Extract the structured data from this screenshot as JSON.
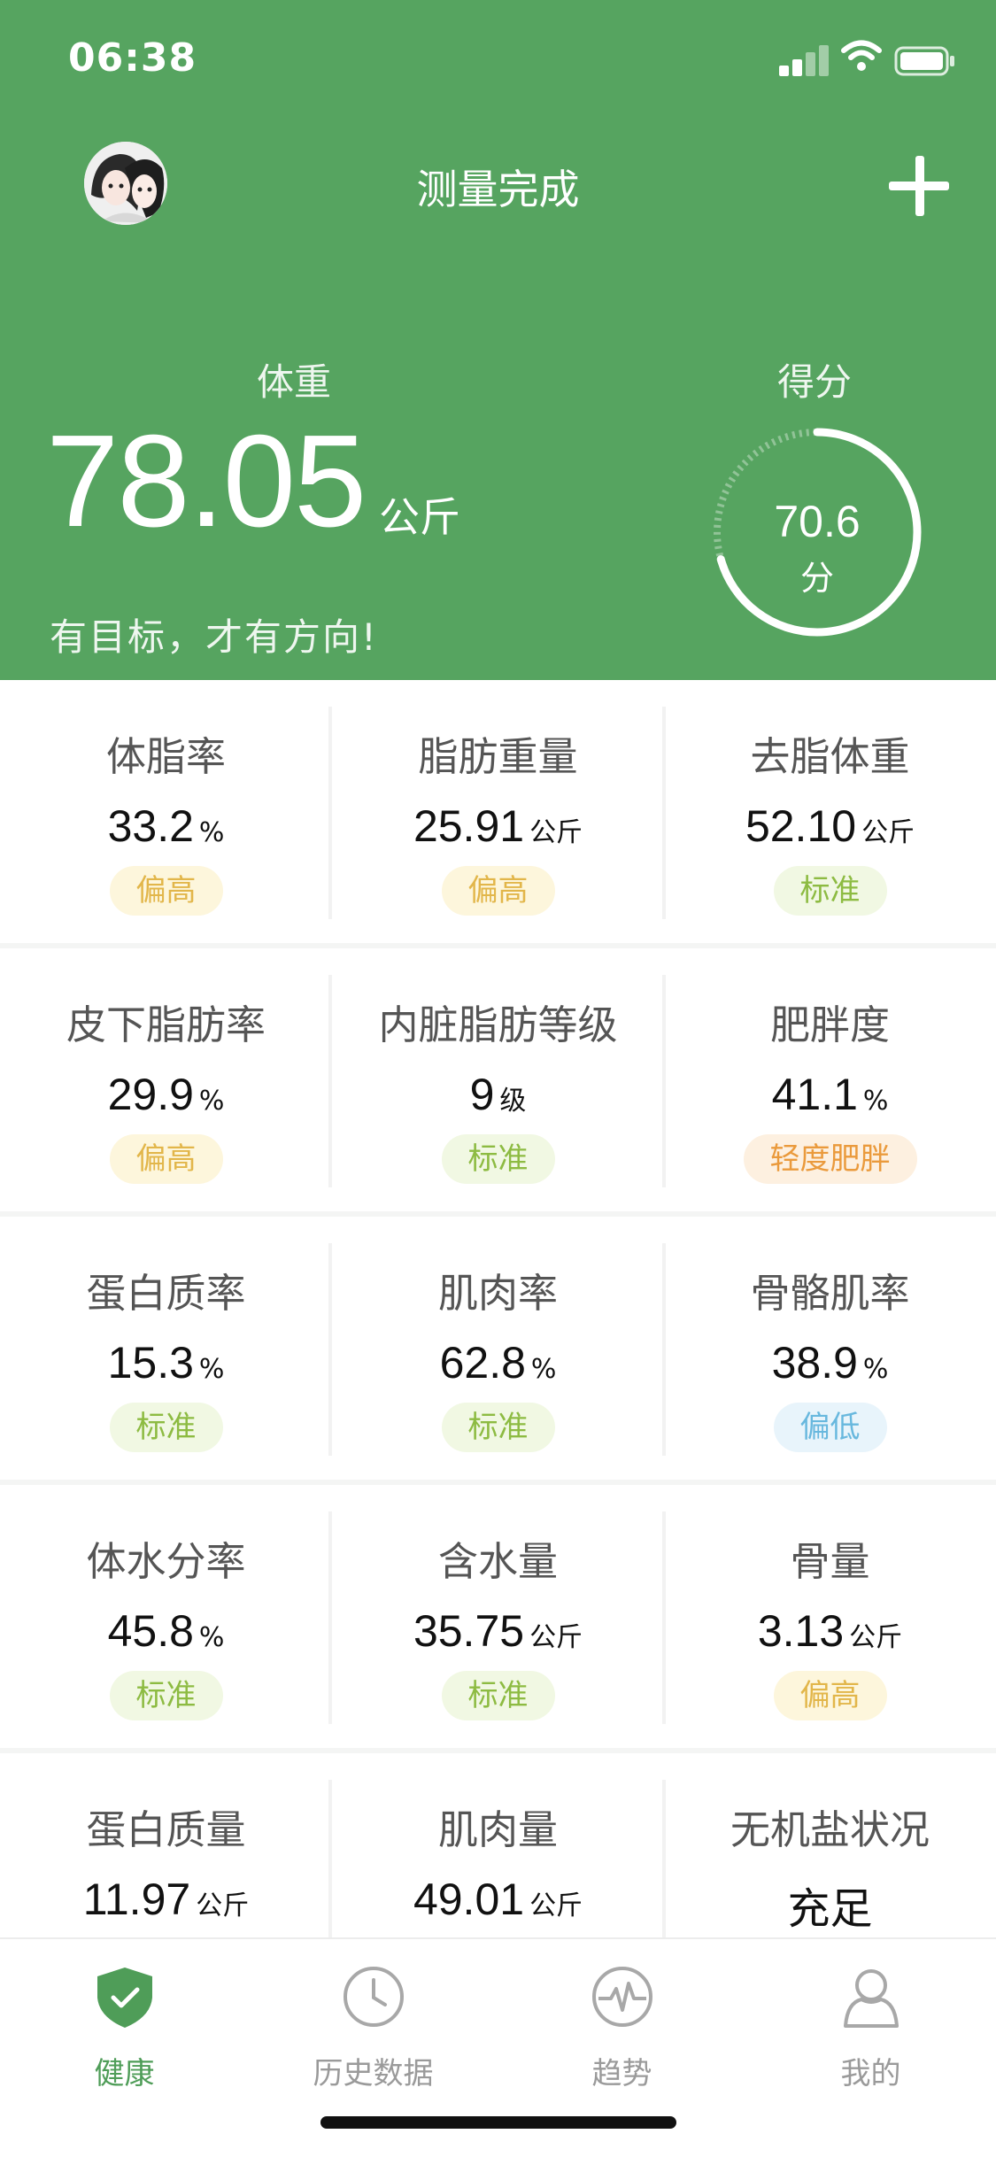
{
  "status_bar": {
    "time": "06:38"
  },
  "header": {
    "title": "测量完成",
    "weight_label": "体重",
    "weight_value": "78.05",
    "weight_unit": "公斤",
    "motto": "有目标，才有方向!",
    "score_label": "得分",
    "score_value": "70.6",
    "score_unit": "分",
    "score_fraction": 0.706,
    "accent_color": "#56a460"
  },
  "metrics": [
    [
      {
        "label": "体脂率",
        "value": "33.2",
        "unit": "%",
        "status": "偏高",
        "level": "high"
      },
      {
        "label": "脂肪重量",
        "value": "25.91",
        "unit": "公斤",
        "status": "偏高",
        "level": "high"
      },
      {
        "label": "去脂体重",
        "value": "52.10",
        "unit": "公斤",
        "status": "标准",
        "level": "normal"
      }
    ],
    [
      {
        "label": "皮下脂肪率",
        "value": "29.9",
        "unit": "%",
        "status": "偏高",
        "level": "high"
      },
      {
        "label": "内脏脂肪等级",
        "value": "9",
        "unit": "级",
        "status": "标准",
        "level": "normal"
      },
      {
        "label": "肥胖度",
        "value": "41.1",
        "unit": "%",
        "status": "轻度肥胖",
        "level": "obese"
      }
    ],
    [
      {
        "label": "蛋白质率",
        "value": "15.3",
        "unit": "%",
        "status": "标准",
        "level": "normal"
      },
      {
        "label": "肌肉率",
        "value": "62.8",
        "unit": "%",
        "status": "标准",
        "level": "normal"
      },
      {
        "label": "骨骼肌率",
        "value": "38.9",
        "unit": "%",
        "status": "偏低",
        "level": "low"
      }
    ],
    [
      {
        "label": "体水分率",
        "value": "45.8",
        "unit": "%",
        "status": "标准",
        "level": "normal"
      },
      {
        "label": "含水量",
        "value": "35.75",
        "unit": "公斤",
        "status": "标准",
        "level": "normal"
      },
      {
        "label": "骨量",
        "value": "3.13",
        "unit": "公斤",
        "status": "偏高",
        "level": "high"
      }
    ],
    [
      {
        "label": "蛋白质量",
        "value": "11.97",
        "unit": "公斤",
        "status": "",
        "level": ""
      },
      {
        "label": "肌肉量",
        "value": "49.01",
        "unit": "公斤",
        "status": "",
        "level": ""
      },
      {
        "label": "无机盐状况",
        "value": "充足",
        "unit": "",
        "status": "",
        "level": "",
        "text_value": true
      }
    ]
  ],
  "status_colors": {
    "high": "#e2b64a",
    "normal": "#8dbb42",
    "low": "#68b8de",
    "obese": "#ea9a3c"
  },
  "tabbar": {
    "items": [
      {
        "label": "健康",
        "icon": "shield-check-icon",
        "active": true
      },
      {
        "label": "历史数据",
        "icon": "clock-icon",
        "active": false
      },
      {
        "label": "趋势",
        "icon": "pulse-icon",
        "active": false
      },
      {
        "label": "我的",
        "icon": "user-icon",
        "active": false
      }
    ]
  }
}
